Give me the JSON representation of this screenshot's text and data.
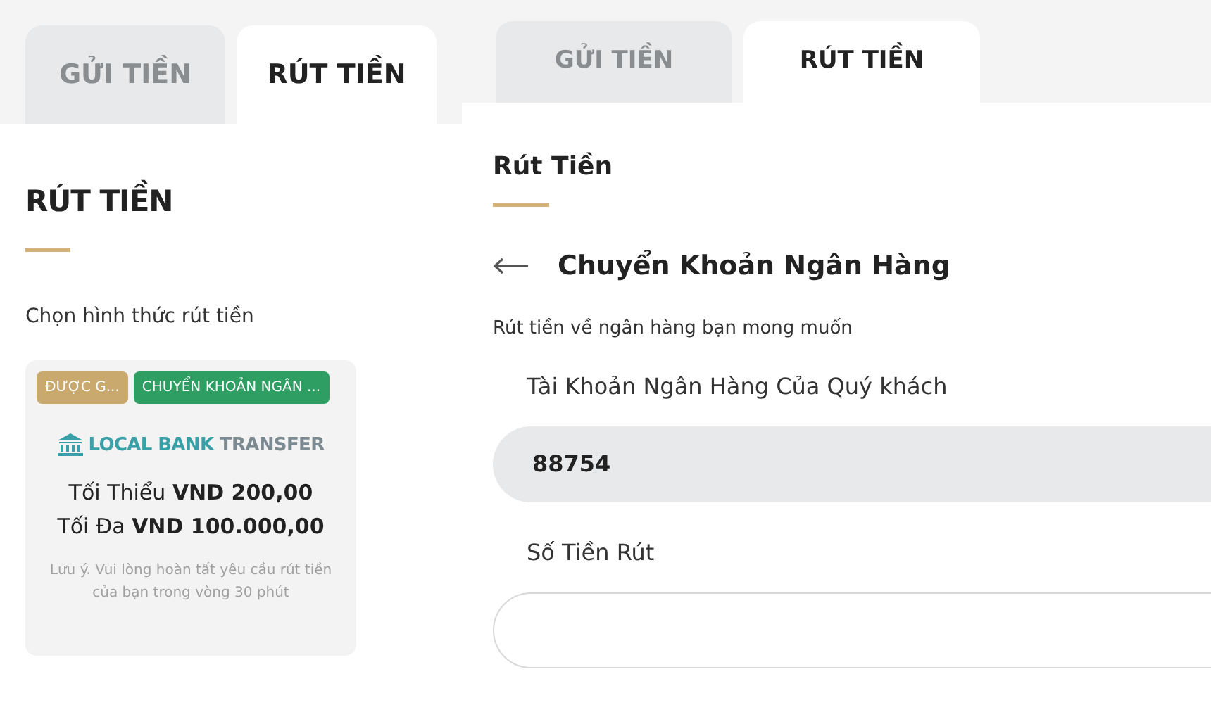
{
  "left_screen": {
    "tabs": [
      {
        "label": "GỬI TIỀN",
        "selected": false
      },
      {
        "label": "RÚT TIỀN",
        "selected": true
      }
    ],
    "heading": "RÚT TIỀN",
    "prompt": "Chọn hình thức rút tiền",
    "method_card": {
      "tags": [
        {
          "label": "ĐƯỢC G...",
          "color": "#c9a96e"
        },
        {
          "label": "CHUYỂN KHOẢN NGÂN ...",
          "color": "#2e9e62"
        }
      ],
      "logo_words": [
        "LOCAL BANK",
        "TRANSFER"
      ],
      "limits": [
        {
          "label": "Tối Thiểu",
          "amount": "VND 200,00"
        },
        {
          "label": "Tối Đa",
          "amount": "VND 100.000,00"
        }
      ],
      "note": "Lưu ý. Vui lòng hoàn tất yêu cầu rút tiền của bạn trong vòng 30 phút"
    }
  },
  "right_screen": {
    "tabs": [
      {
        "label": "GỬI TIỀN",
        "selected": false
      },
      {
        "label": "RÚT TIỀN",
        "selected": true
      }
    ],
    "heading": "Rút Tiền",
    "method_title": "Chuyển Khoản Ngân Hàng",
    "subtitle": "Rút tiền về ngân hàng bạn mong muốn",
    "fields": [
      {
        "label": "Tài Khoản Ngân Hàng Của Quý khách",
        "value": "88754",
        "filled": true
      },
      {
        "label": "Số Tiền Rút",
        "filled": false
      }
    ]
  }
}
